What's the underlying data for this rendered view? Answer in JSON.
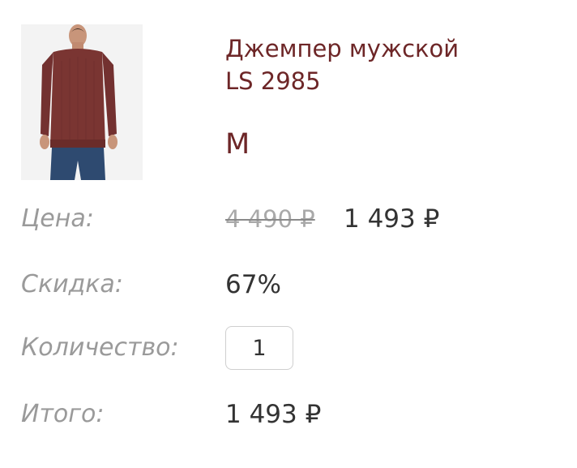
{
  "product": {
    "title_line1": "Джемпер мужской",
    "title_line2": "LS 2985",
    "size": "M",
    "image_icon": "man-in-red-sweater-photo"
  },
  "rows": {
    "price_label": "Цена:",
    "price_old": "4 490 ₽",
    "price_new": "1 493 ₽",
    "discount_label": "Скидка:",
    "discount_value": "67%",
    "quantity_label": "Количество:",
    "quantity_value": "1",
    "total_label": "Итого:",
    "total_value": "1 493 ₽"
  },
  "colors": {
    "brand": "#6d2627",
    "label": "#9a9a9a",
    "text": "#333333",
    "strike": "#a9a9a9"
  }
}
